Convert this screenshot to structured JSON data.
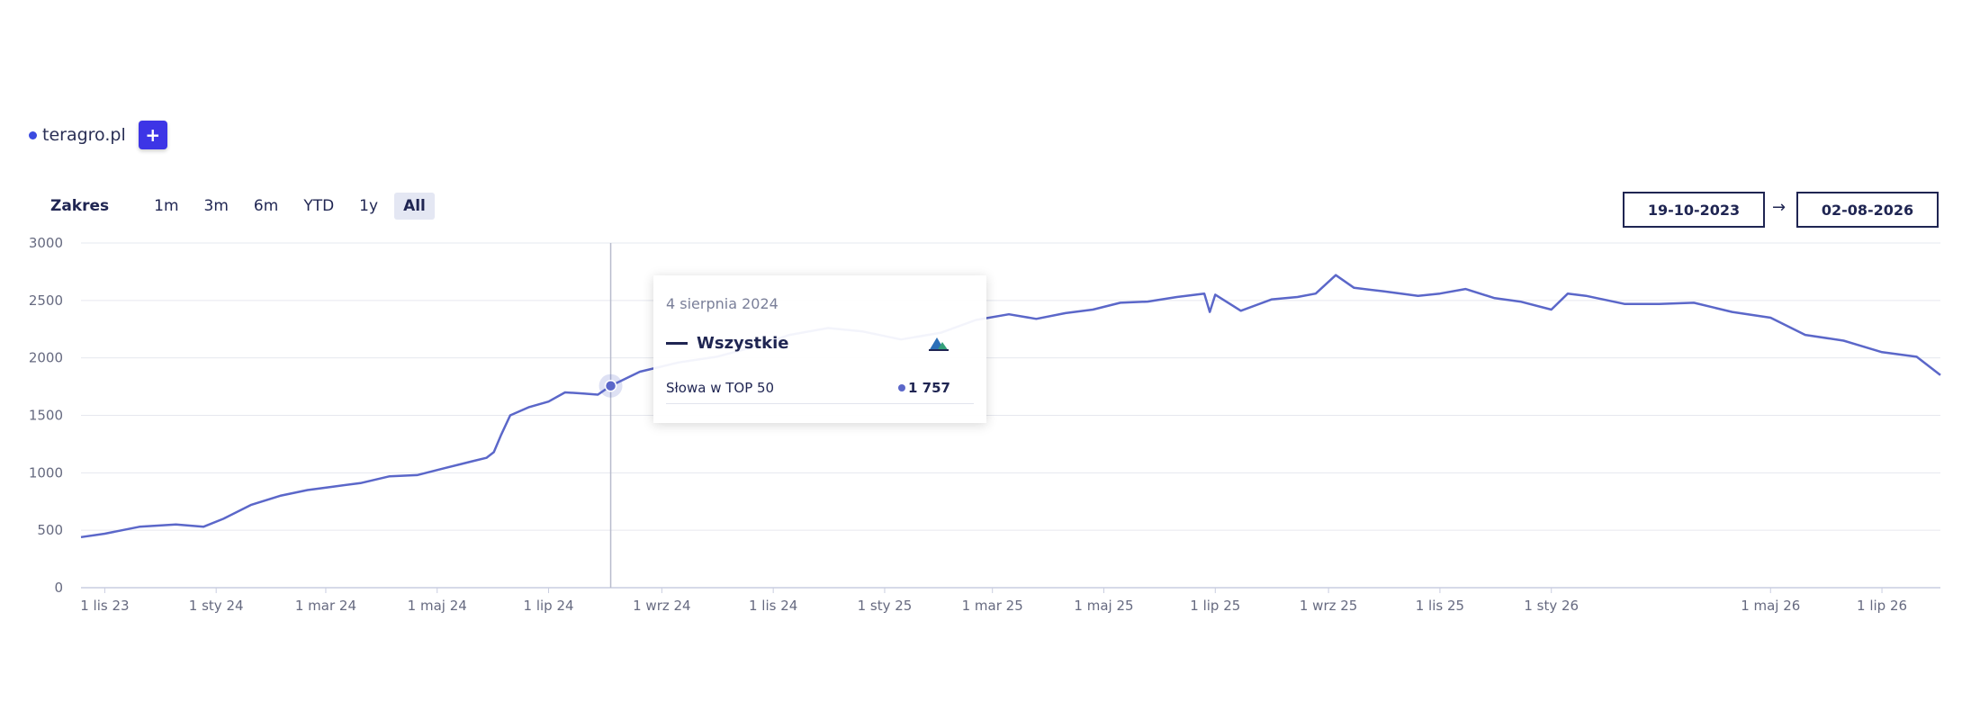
{
  "legend": {
    "site": "teragro.pl",
    "add_label": "+"
  },
  "range": {
    "label": "Zakres",
    "options": [
      "1m",
      "3m",
      "6m",
      "YTD",
      "1y",
      "All"
    ],
    "active": "All"
  },
  "dates": {
    "from": "19-10-2023",
    "arrow": "→",
    "to": "02-08-2026"
  },
  "tooltip": {
    "date": "4 sierpnia 2024",
    "series": "Wszystkie",
    "metric_label": "Słowa w TOP 50",
    "metric_value": "1 757"
  },
  "colors": {
    "line": "#5b67c9",
    "accent": "#3d35e6",
    "text": "#1f2552",
    "grid": "#e6e8ef"
  },
  "chart_data": {
    "type": "line",
    "title": "",
    "xlabel": "",
    "ylabel": "",
    "ylim": [
      0,
      3000
    ],
    "yticks": [
      0,
      500,
      1000,
      1500,
      2000,
      2500,
      3000
    ],
    "xlim": [
      "2023-10-19",
      "2026-08-02"
    ],
    "xticks": [
      {
        "date": "2023-11-01",
        "label": "1 lis 23"
      },
      {
        "date": "2024-01-01",
        "label": "1 sty 24"
      },
      {
        "date": "2024-03-01",
        "label": "1 mar 24"
      },
      {
        "date": "2024-05-01",
        "label": "1 maj 24"
      },
      {
        "date": "2024-07-01",
        "label": "1 lip 24"
      },
      {
        "date": "2024-09-01",
        "label": "1 wrz 24"
      },
      {
        "date": "2024-11-01",
        "label": "1 lis 24"
      },
      {
        "date": "2025-01-01",
        "label": "1 sty 25"
      },
      {
        "date": "2025-03-01",
        "label": "1 mar 25"
      },
      {
        "date": "2025-05-01",
        "label": "1 maj 25"
      },
      {
        "date": "2025-07-01",
        "label": "1 lip 25"
      },
      {
        "date": "2025-09-01",
        "label": "1 wrz 25"
      },
      {
        "date": "2025-11-01",
        "label": "1 lis 25"
      },
      {
        "date": "2026-01-01",
        "label": "1 sty 26"
      },
      {
        "date": "2026-05-01",
        "label": "1 maj 26"
      },
      {
        "date": "2026-07-01",
        "label": "1 lip 26"
      }
    ],
    "grid": true,
    "highlight": {
      "date": "2024-08-04",
      "value": 1757
    },
    "series": [
      {
        "name": "Wszystkie",
        "x": [
          "2023-10-19",
          "2023-11-01",
          "2023-11-20",
          "2023-12-10",
          "2023-12-25",
          "2024-01-05",
          "2024-01-20",
          "2024-02-05",
          "2024-02-20",
          "2024-03-05",
          "2024-03-20",
          "2024-04-05",
          "2024-04-20",
          "2024-05-05",
          "2024-05-20",
          "2024-05-28",
          "2024-06-01",
          "2024-06-05",
          "2024-06-10",
          "2024-06-20",
          "2024-07-01",
          "2024-07-10",
          "2024-07-20",
          "2024-07-28",
          "2024-08-04",
          "2024-08-20",
          "2024-09-10",
          "2024-10-01",
          "2024-10-20",
          "2024-11-10",
          "2024-12-01",
          "2024-12-20",
          "2025-01-10",
          "2025-02-01",
          "2025-02-20",
          "2025-03-10",
          "2025-03-25",
          "2025-04-10",
          "2025-04-25",
          "2025-05-10",
          "2025-05-25",
          "2025-06-10",
          "2025-06-25",
          "2025-06-28",
          "2025-07-01",
          "2025-07-10",
          "2025-07-15",
          "2025-08-01",
          "2025-08-15",
          "2025-08-25",
          "2025-09-05",
          "2025-09-15",
          "2025-10-01",
          "2025-10-20",
          "2025-11-01",
          "2025-11-15",
          "2025-12-01",
          "2025-12-15",
          "2026-01-01",
          "2026-01-10",
          "2026-01-20",
          "2026-02-10",
          "2026-03-01",
          "2026-03-20",
          "2026-04-10",
          "2026-05-01",
          "2026-05-20",
          "2026-06-10",
          "2026-07-01",
          "2026-07-20",
          "2026-08-02"
        ],
        "values": [
          440,
          470,
          530,
          550,
          530,
          600,
          720,
          800,
          850,
          880,
          910,
          970,
          980,
          1040,
          1100,
          1130,
          1180,
          1330,
          1500,
          1570,
          1620,
          1700,
          1690,
          1680,
          1757,
          1880,
          1960,
          2010,
          2090,
          2200,
          2260,
          2230,
          2160,
          2220,
          2330,
          2380,
          2340,
          2390,
          2420,
          2480,
          2490,
          2530,
          2560,
          2400,
          2550,
          2460,
          2410,
          2510,
          2530,
          2560,
          2720,
          2610,
          2580,
          2540,
          2560,
          2600,
          2520,
          2490,
          2420,
          2560,
          2540,
          2470,
          2470,
          2480,
          2400,
          2350,
          2200,
          2150,
          2050,
          2010,
          1850
        ]
      }
    ]
  }
}
